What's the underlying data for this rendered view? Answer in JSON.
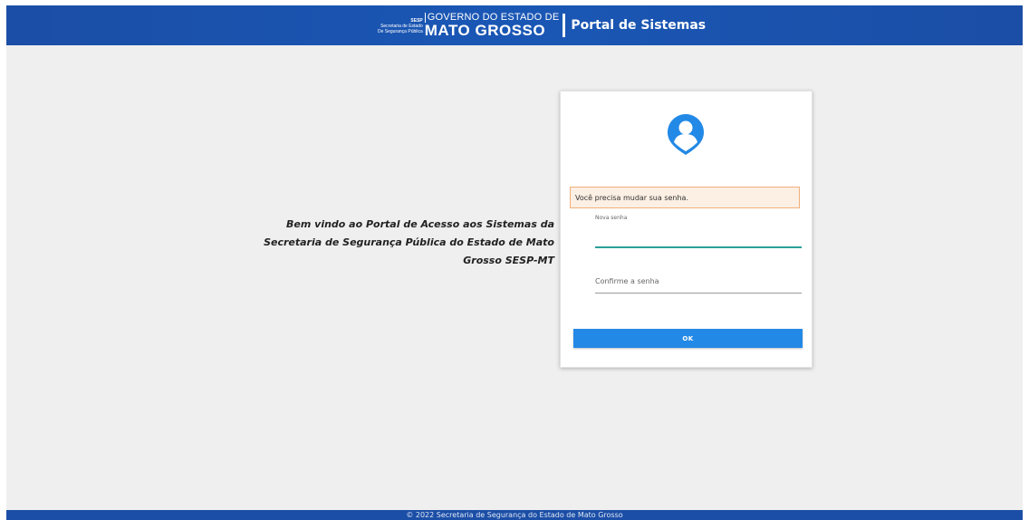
{
  "header": {
    "brand_sesp": "SESP",
    "brand_secretaria_line1": "Secretaria de Estado",
    "brand_secretaria_line2": "De Segurança Pública",
    "brand_gov_top": "GOVERNO DO ESTADO DE",
    "brand_gov_bottom": "MATO GROSSO",
    "portal_title": "Portal de Sistemas"
  },
  "welcome": {
    "message": "Bem vindo ao Portal de Acesso aos Sistemas da Secretaria de Segurança Pública do Estado de Mato Grosso SESP-MT"
  },
  "login_card": {
    "avatar_icon": "user-location-icon",
    "alert_text": "Você precisa mudar sua senha.",
    "new_password": {
      "label": "Nova senha",
      "value": ""
    },
    "confirm_password": {
      "placeholder": "Confirme a senha",
      "value": ""
    },
    "ok_label": "OK"
  },
  "footer": {
    "copyright": "© 2022 Secretaria de Segurança do Estado de Mato Grosso"
  },
  "colors": {
    "header_blue": "#1b4ea6",
    "page_background": "#efefef",
    "button_blue": "#2389e6",
    "avatar_blue": "#2389e6",
    "input_focus_teal": "#2b9f9b",
    "alert_background": "#fcefe3",
    "alert_border": "#f0b07a"
  }
}
